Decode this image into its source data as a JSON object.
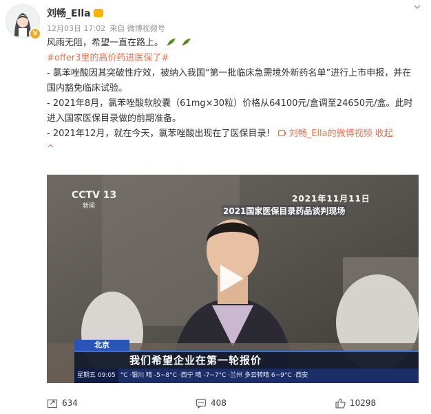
{
  "user": {
    "name": "刘畅_Ella"
  },
  "post": {
    "date": "12月03日 17:02",
    "source": "来自 微博视频号",
    "line1": "风雨无阻，希望一直在路上。",
    "hashtag": "#offer3里的高价药进医保了#",
    "para1": "- 氯苯唑酸因其突破性疗效，被纳入我国“第一批临床急需境外新药名单”进行上市申报，并在国内豁免临床试验。",
    "para2": "- 2021年8月，氯苯唑酸软胶囊（61mg×30粒）价格从64100元/盒调至24650元/盒。此时进入国家医保目录做的前期准备。",
    "para3_text": "- 2021年12月，就在今天，氯苯唑酸出现在了医保目录！",
    "video_link": "刘畅_Ella的微博视频",
    "collapse": "收起",
    "collapse_arrow": "^"
  },
  "video": {
    "channel": "CCTV 13",
    "channel_sub": "新闻",
    "date": "2021年11月11日",
    "caption_top": "2021国家医保目录药品谈判现场",
    "location": "北京",
    "subtitle": "我们希望企业在第一轮报价",
    "weekday_time": "星期五  09:05",
    "ticker": "°C ·银川 晴 -5~8°C ·西宁 晴 -7~7°C ·兰州 多云转晴 6~9°C ·西安"
  },
  "actions": {
    "repost_count": "634",
    "comment_count": "408",
    "like_count": "10298"
  },
  "icons": {
    "menu": "chevron-down-icon",
    "repost": "repost-icon",
    "comment": "comment-icon",
    "like": "thumbs-up-icon",
    "play": "play-icon",
    "video_link": "video-link-icon"
  },
  "colors": {
    "link": "#eb7350",
    "meta": "#939393",
    "leaf": "#6a9b2f"
  }
}
